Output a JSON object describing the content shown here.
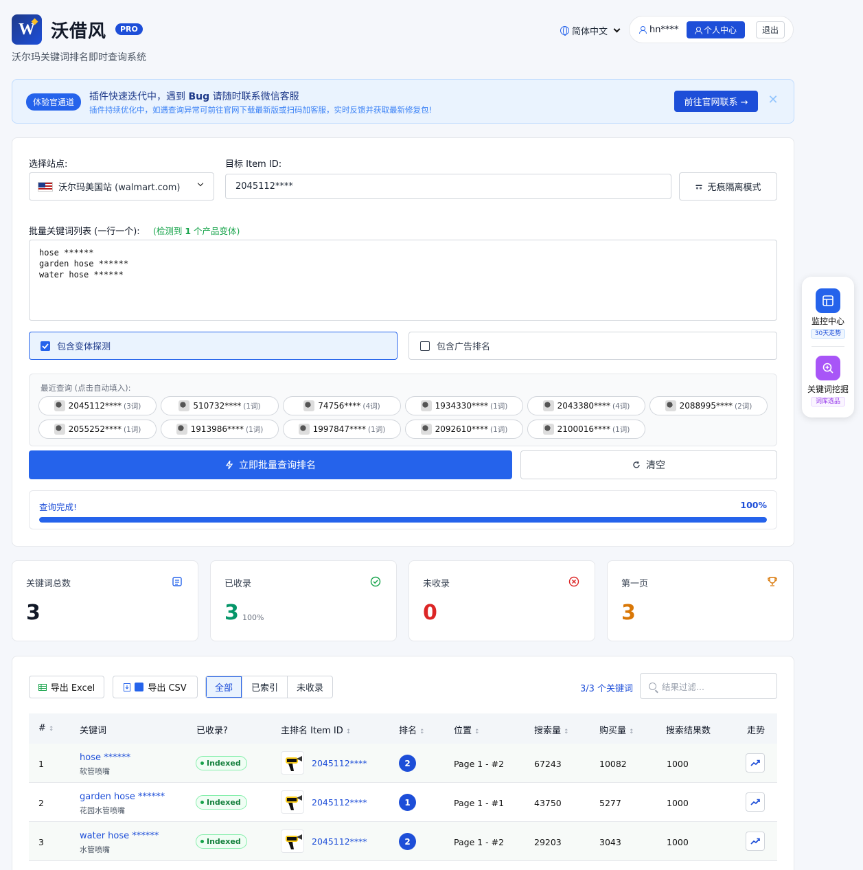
{
  "header": {
    "logo_letter": "W",
    "brand": "沃借风",
    "pro_badge": "PRO",
    "subtitle": "沃尔玛关键词排名即时查询系统",
    "language": "简体中文",
    "username": "hn****",
    "center_label": "个人中心",
    "logout_label": "退出"
  },
  "banner": {
    "tag": "体验官通道",
    "title_prefix": "插件快速迭代中，遇到 ",
    "title_bold": "Bug",
    "title_suffix": " 请随时联系微信客服",
    "subtitle": "插件持续优化中，如遇查询异常可前往官网下载最新版或扫码加客服，实时反馈并获取最新修复包!",
    "button": "前往官网联系 →",
    "close": "✕"
  },
  "query": {
    "site_label": "选择站点:",
    "site_value": "沃尔玛美国站 (walmart.com)",
    "item_label": "目标 Item ID:",
    "item_value": "2045112****",
    "incognito_label": "无痕隔离模式",
    "keywords_label": "批量关键词列表 (一行一个):",
    "detected_prefix": "(检测到 ",
    "detected_count": "1",
    "detected_suffix": " 个产品变体)",
    "keywords_text": "hose ******\ngarden hose ******\nwater hose ******",
    "variant_option": "包含变体探测",
    "variant_checked": true,
    "ad_option": "包含广告排名",
    "ad_checked": false,
    "recent_label": "最近查询 (点击自动填入):",
    "recent": [
      {
        "id": "2045112****",
        "count": "(3词)"
      },
      {
        "id": "510732****",
        "count": "(1词)"
      },
      {
        "id": "74756****",
        "count": "(4词)"
      },
      {
        "id": "1934330****",
        "count": "(1词)"
      },
      {
        "id": "2043380****",
        "count": "(4词)"
      },
      {
        "id": "2088995****",
        "count": "(2词)"
      },
      {
        "id": "2055252****",
        "count": "(1词)"
      },
      {
        "id": "1913986****",
        "count": "(1词)"
      },
      {
        "id": "1997847****",
        "count": "(1词)"
      },
      {
        "id": "2092610****",
        "count": "(1词)"
      },
      {
        "id": "2100016****",
        "count": "(1词)"
      }
    ],
    "run_label": "立即批量查询排名",
    "clear_label": "清空",
    "progress_label": "查询完成!",
    "progress_pct": "100%",
    "progress_value": 1.0
  },
  "stats": [
    {
      "label": "关键词总数",
      "value": "3",
      "sub": "",
      "color": "#111827",
      "icon": "document-icon"
    },
    {
      "label": "已收录",
      "value": "3",
      "sub": "100%",
      "color": "#059669",
      "icon": "check-circle-icon"
    },
    {
      "label": "未收录",
      "value": "0",
      "sub": "",
      "color": "#dc2626",
      "icon": "x-circle-icon"
    },
    {
      "label": "第一页",
      "value": "3",
      "sub": "",
      "color": "#d97706",
      "icon": "trophy-icon"
    }
  ],
  "results": {
    "export_excel": "导出 Excel",
    "export_csv": "导出 CSV",
    "tabs": [
      "全部",
      "已索引",
      "未收录"
    ],
    "active_tab": 0,
    "count_label": "3/3 个关键词",
    "filter_placeholder": "结果过滤...",
    "columns": [
      "#",
      "关键词",
      "已收录?",
      "主排名 Item ID",
      "排名",
      "位置",
      "搜索量",
      "购买量",
      "搜索结果数",
      "走势"
    ],
    "rows": [
      {
        "n": "1",
        "keyword": "hose ******",
        "keyword_cn": "软管喷嘴",
        "status": "Indexed",
        "item_id": "2045112****",
        "rank": "2",
        "position": "Page 1 - #2",
        "search": "67243",
        "buy": "10082",
        "results": "1000"
      },
      {
        "n": "2",
        "keyword": "garden hose ******",
        "keyword_cn": "花园水管喷嘴",
        "status": "Indexed",
        "item_id": "2045112****",
        "rank": "1",
        "position": "Page 1 - #1",
        "search": "43750",
        "buy": "5277",
        "results": "1000"
      },
      {
        "n": "3",
        "keyword": "water hose ******",
        "keyword_cn": "水管喷嘴",
        "status": "Indexed",
        "item_id": "2045112****",
        "rank": "2",
        "position": "Page 1 - #2",
        "search": "29203",
        "buy": "3043",
        "results": "1000"
      }
    ]
  },
  "side": {
    "monitor_label": "监控中心",
    "monitor_tag": "30天走势",
    "mining_label": "关键词挖掘",
    "mining_tag": "词库选品"
  }
}
